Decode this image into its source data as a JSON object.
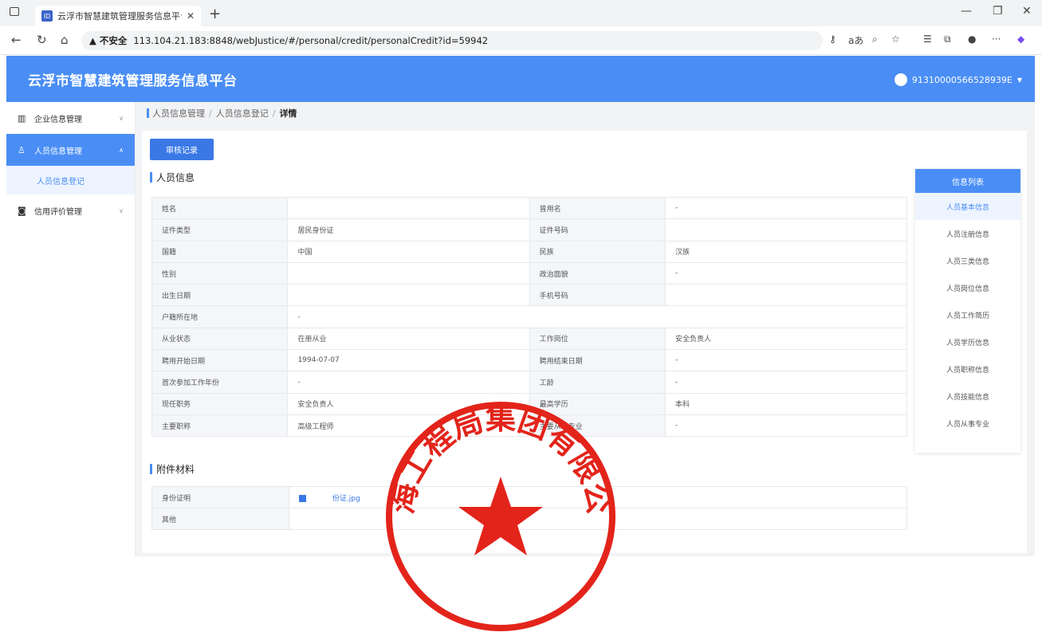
{
  "browser": {
    "tab_title": "云浮市智慧建筑管理服务信息平台",
    "favicon_text": "ID",
    "url": "113.104.21.183:8848/webJustice/#/personal/credit/personalCredit?id=59942",
    "security_label": "不安全"
  },
  "header": {
    "title": "云浮市智慧建筑管理服务信息平台",
    "user": "91310000566528939E"
  },
  "sidebar": {
    "items": [
      {
        "label": "企业信息管理"
      },
      {
        "label": "人员信息管理"
      },
      {
        "label": "信用评价管理"
      }
    ],
    "sub_item": "人员信息登记"
  },
  "breadcrumb": {
    "l1": "人员信息管理",
    "l2": "人员信息登记",
    "current": "详情"
  },
  "audit_button": "审核记录",
  "section_person": "人员信息",
  "info_rows": [
    [
      "姓名",
      "",
      "曾用名",
      "-"
    ],
    [
      "证件类型",
      "居民身份证",
      "证件号码",
      ""
    ],
    [
      "国籍",
      "中国",
      "民族",
      "汉族"
    ],
    [
      "性别",
      "",
      "政治面貌",
      "-"
    ],
    [
      "出生日期",
      "",
      "手机号码",
      ""
    ],
    [
      "户籍所在地",
      "-"
    ],
    [
      "从业状态",
      "在册从业",
      "工作岗位",
      "安全负责人"
    ],
    [
      "聘用开始日期",
      "1994-07-07",
      "聘用结束日期",
      "-"
    ],
    [
      "首次参加工作年份",
      "-",
      "工龄",
      "-"
    ],
    [
      "现任职务",
      "安全负责人",
      "最高学历",
      "本科"
    ],
    [
      "主要职称",
      "高级工程师",
      "主要从事专业",
      "-"
    ]
  ],
  "side_panel": {
    "title": "信息列表",
    "items": [
      "人员基本信息",
      "人员注册信息",
      "人员三类信息",
      "人员岗位信息",
      "人员工作简历",
      "人员学历信息",
      "人员职称信息",
      "人员技能信息",
      "人员从事专业"
    ]
  },
  "section_attach": "附件材料",
  "attachments": [
    {
      "label": "身份证明",
      "file": "份证.jpg"
    },
    {
      "label": "其他",
      "file": ""
    }
  ],
  "seal": {
    "text": "上海工程局集团有限公司",
    "color": "#e3241b"
  }
}
